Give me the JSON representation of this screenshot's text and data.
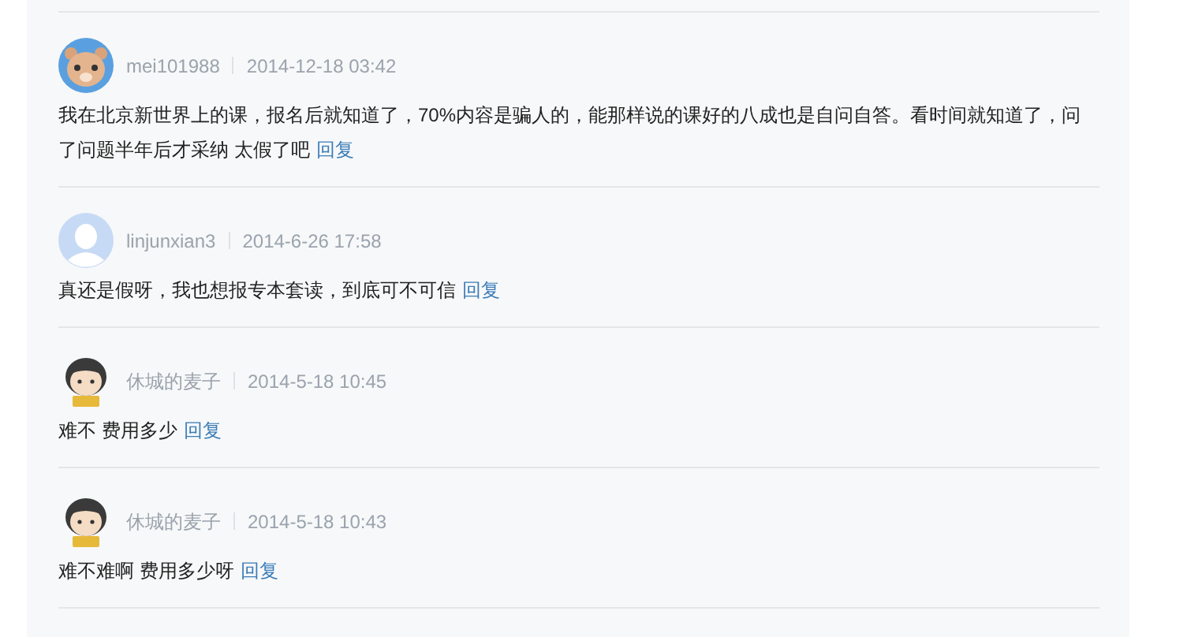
{
  "comments": [
    {
      "kind": "bear",
      "user": "mei101988",
      "time": "2014-12-18 03:42",
      "text": "我在北京新世界上的课，报名后就知道了，70%内容是骗人的，能那样说的课好的八成也是自问自答。看时间就知道了，问了问题半年后才采纳 太假了吧",
      "reply": "回复"
    },
    {
      "kind": "default",
      "user": "linjunxian3",
      "time": "2014-6-26 17:58",
      "text": "真还是假呀，我也想报专本套读，到底可不可信",
      "reply": "回复"
    },
    {
      "kind": "cartoon",
      "user": "休城的麦子",
      "time": "2014-5-18 10:45",
      "text": "难不 费用多少",
      "reply": "回复"
    },
    {
      "kind": "cartoon",
      "user": "休城的麦子",
      "time": "2014-5-18 10:43",
      "text": "难不难啊 费用多少呀",
      "reply": "回复"
    }
  ]
}
